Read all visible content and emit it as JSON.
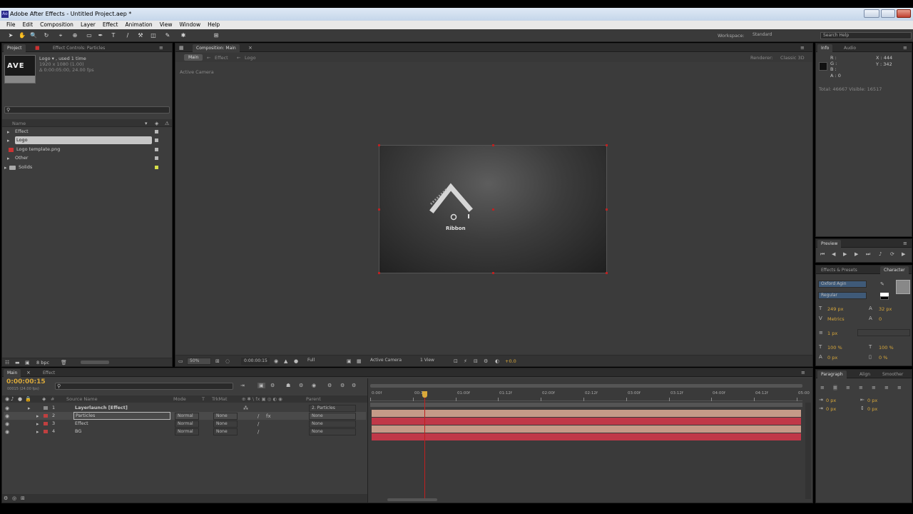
{
  "window": {
    "title": "Adobe After Effects - Untitled Project.aep *",
    "app_icon": "Ae"
  },
  "menu": [
    "File",
    "Edit",
    "Composition",
    "Layer",
    "Effect",
    "Animation",
    "View",
    "Window",
    "Help"
  ],
  "toolbar": {
    "workspace_label": "Workspace:",
    "workspace_value": "Standard",
    "search_placeholder": "Search Help"
  },
  "project_panel": {
    "tabs": [
      "Project",
      "Effect Controls: Particles"
    ],
    "selected_name": "Logo ▾ , used 1 time",
    "selected_dims": "1920 x 1080 (1.00)",
    "selected_duration": "Δ 0:00:05:00, 24.00 fps",
    "thumb_text": "AVE",
    "search_placeholder": "",
    "column_name": "Name",
    "items": [
      {
        "name": "Effect",
        "type": "comp",
        "label": "#b8b8b8"
      },
      {
        "name": "Logo",
        "type": "comp",
        "label": "#b8b8b8",
        "selected": true
      },
      {
        "name": "Logo template.png",
        "type": "image",
        "label": "#b8b8b8"
      },
      {
        "name": "Other",
        "type": "comp",
        "label": "#b8b8b8"
      },
      {
        "name": "Solids",
        "type": "folder",
        "label": "#d6e04a"
      }
    ],
    "footer_bpc": "8 bpc"
  },
  "composition_panel": {
    "tab": "Composition: Main",
    "breadcrumbs": [
      "Main",
      "Effect",
      "Logo"
    ],
    "renderer_label": "Renderer:",
    "renderer_value": "Classic 3D",
    "active_camera_label": "Active Camera",
    "logo_text": "Ribbon",
    "bottom": {
      "zoom": "50%",
      "timecode": "0:00:00:15",
      "resolution": "Full",
      "camera": "Active Camera",
      "views": "1 View",
      "exposure": "+0.0"
    }
  },
  "info_panel": {
    "tabs": [
      "Info",
      "Audio"
    ],
    "x": "X : 444",
    "y": "Y : 342",
    "r": "R :",
    "g": "G :",
    "b": "B :",
    "a": "A : 0",
    "total_visible": "Total: 46667  Visible: 16517"
  },
  "preview_panel": {
    "tab": "Preview"
  },
  "character_panel": {
    "tabs": [
      "Effects & Presets",
      "Character"
    ],
    "font_family": "Oxford Agin",
    "font_style": "Regular",
    "font_size": "249 px",
    "leading": "32 px",
    "kerning": "Metrics",
    "tracking": "0",
    "stroke_width": "1 px",
    "vertical_scale": "100 %",
    "horizontal_scale": "100 %",
    "baseline_shift": "0 px",
    "tsume": "0 %"
  },
  "paragraph_panel": {
    "tabs": [
      "Paragraph",
      "Align",
      "Smoother"
    ],
    "indent_left": "0 px",
    "indent_right": "0 px",
    "space_before": "0 px",
    "indent_first": "0 px",
    "space_after": "0 px"
  },
  "timeline": {
    "tabs": [
      "Main",
      "Effect"
    ],
    "timecode": "0:00:00:15",
    "timecode_sub": "00015 (24.00 fps)",
    "search_placeholder": "",
    "columns": [
      "Source Name",
      "Mode",
      "T",
      "TrkMat",
      "Parent"
    ],
    "layers": [
      {
        "num": "1",
        "name": "Layerlaunch [Effect]",
        "mode": "",
        "trk": "",
        "parent": "2. Particles",
        "label": "#8a8a8a",
        "bold": true
      },
      {
        "num": "2",
        "name": "Particles",
        "mode": "Normal",
        "trk": "None",
        "parent": "None",
        "label": "#c04040",
        "selected": true
      },
      {
        "num": "3",
        "name": "Effect",
        "mode": "Normal",
        "trk": "None",
        "parent": "None",
        "label": "#c04040"
      },
      {
        "num": "4",
        "name": "BG",
        "mode": "Normal",
        "trk": "None",
        "parent": "None",
        "label": "#c04040"
      }
    ],
    "ruler": [
      "0:00f",
      "00:12f",
      "01:00f",
      "01:12f",
      "02:00f",
      "02:12f",
      "03:00f",
      "03:12f",
      "04:00f",
      "04:12f",
      "05:00"
    ],
    "playhead_fraction": 0.125,
    "bar_colors": [
      "#c59a88",
      "#c03848",
      "#c59a88",
      "#c03848"
    ]
  },
  "colors": {
    "panel_bg": "#3d3d3d",
    "accent_yellow": "#e8c84a",
    "timecode": "#d9a83a",
    "playhead": "#c02020"
  }
}
